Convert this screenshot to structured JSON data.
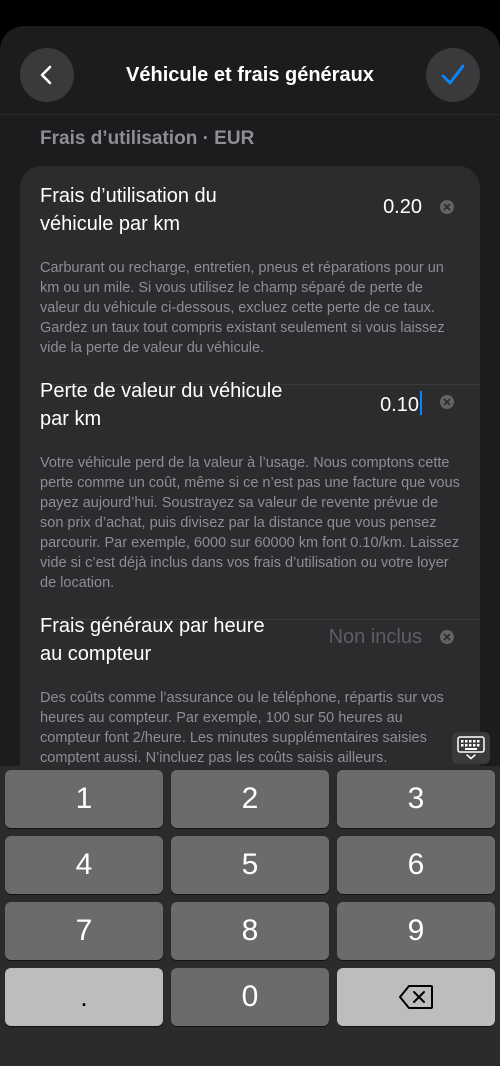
{
  "nav": {
    "title": "Véhicule et frais généraux",
    "back_icon": "chevron-left-icon",
    "done_icon": "checkmark-icon",
    "accent": "#0a84ff"
  },
  "section": {
    "header": "Frais d’utilisation · EUR"
  },
  "fields": [
    {
      "title": "Frais d’utilisation du véhicule par km",
      "value": "0.20",
      "description": "Carburant ou recharge, entretien, pneus et réparations pour un km ou un mile. Si vous utilisez le champ séparé de perte de valeur du véhicule ci-dessous, excluez cette perte de ce taux. Gardez un taux tout compris existant seulement si vous laissez vide la perte de valeur du véhicule."
    },
    {
      "title": "Perte de valeur du véhicule par km",
      "value": "0.10",
      "description": "Votre véhicule perd de la valeur à l’usage. Nous comptons cette perte comme un coût, même si ce n’est pas une facture que vous payez aujourd’hui. Soustrayez sa valeur de revente prévue de son prix d’achat, puis divisez par la distance que vous pensez parcourir. Par exemple, 6000 sur 60000 km font 0.10/km. Laissez vide si c’est déjà inclus dans vos frais d’utilisation ou votre loyer de location."
    },
    {
      "title": "Frais généraux par heure au compteur",
      "value": "",
      "placeholder": "Non inclus",
      "description": "Des coûts comme l’assurance ou le téléphone, répartis sur vos heures au compteur. Par exemple, 100 sur 50 heures au compteur font 2/heure. Les minutes supplémentaires saisies comptent aussi. N’incluez pas les coûts saisis ailleurs."
    }
  ],
  "keyboard": {
    "keys": [
      "1",
      "2",
      "3",
      "4",
      "5",
      "6",
      "7",
      "8",
      "9",
      ".",
      "0"
    ],
    "delete_icon": "backspace-icon",
    "toggle_icon": "keyboard-dismiss-icon"
  }
}
